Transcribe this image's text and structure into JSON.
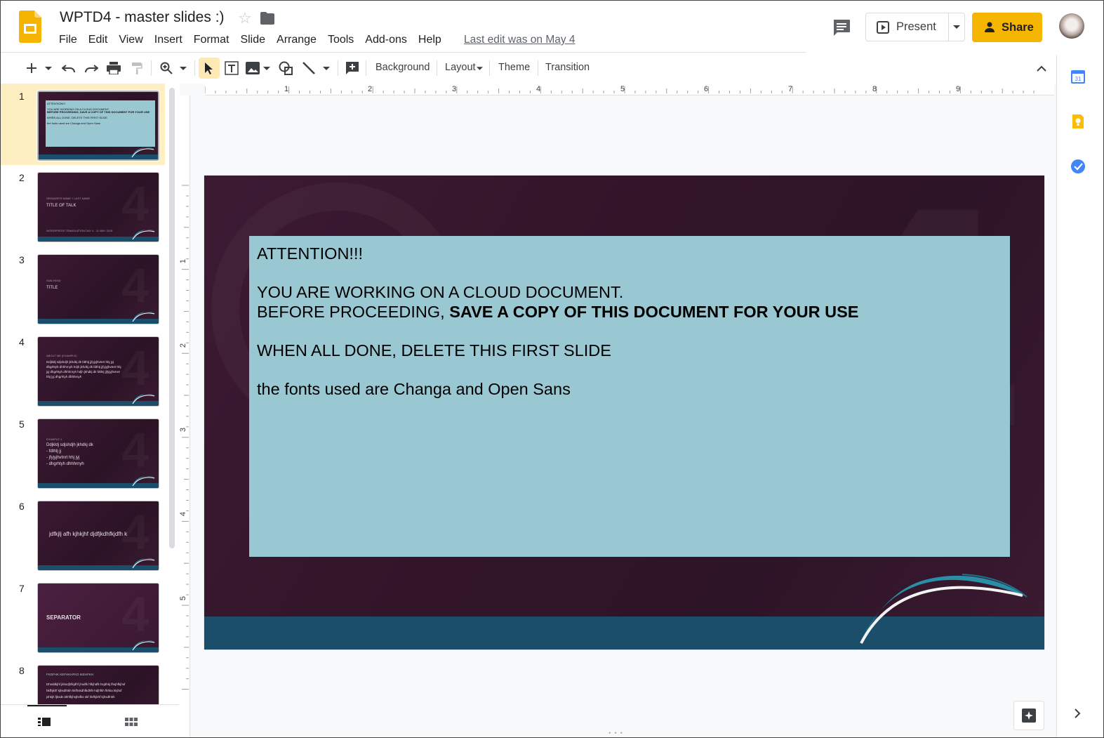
{
  "header": {
    "doc_title": "WPTD4 - master slides :)",
    "menu": [
      "File",
      "Edit",
      "View",
      "Insert",
      "Format",
      "Slide",
      "Arrange",
      "Tools",
      "Add-ons",
      "Help"
    ],
    "last_edit": "Last edit was on May 4",
    "present_label": "Present",
    "share_label": "Share",
    "accent_color": "#f6b500"
  },
  "toolbar": {
    "background_label": "Background",
    "layout_label": "Layout",
    "theme_label": "Theme",
    "transition_label": "Transition"
  },
  "filmstrip": {
    "slides": [
      {
        "num": "1",
        "lines": [
          "ATTENTION!!!",
          "YOU ARE WORKING ON A CLOUD DOCUMENT.",
          "BEFORE PROCEEDING, SAVE A COPY OF THIS DOCUMENT FOR YOUR USE",
          "WHEN ALL DONE, DELETE THIS FIRST SLIDE",
          "the fonts used are Changa and Open Sans"
        ]
      },
      {
        "num": "2",
        "lines": [
          "SPEAKER'S NAME + LAST NAME",
          "TITLE OF TALK",
          "WORDPRESS TRANSLATION DAY 4 - 11 MAY 2019"
        ]
      },
      {
        "num": "3",
        "lines": [
          "SUB-HEAD",
          "TITLE"
        ]
      },
      {
        "num": "4",
        "lines": [
          "ABOUT ME (EXAMPLE)",
          "Ddjkldj sdjshdjh jkhdkj dk fdthtj jjfyjyjhvtnrt hhj jyj",
          "dhgrhtyh dhhhrnyh hdjh jkhdkj dk fdthtj jjfyjyjhvtnrt hhj",
          "jyj dhgrhtyh dhhhrnyh hdjh jkhdkj dk fdthtj jjfyjyjhvtnrt",
          "hhj jyj dhgrhtyh dhhhrnyh"
        ]
      },
      {
        "num": "5",
        "lines": [
          "EXAMPLE 1",
          "Ddjkldj sdjshdjh jkhdkj dk",
          "- fdthtj jj",
          "- jfyjyjhvtnrt hhj jyj",
          "- dhgrhtyh dhhhrnyh"
        ]
      },
      {
        "num": "6",
        "lines": [
          "jdfkjlj afh kjhkjhf djdfjkdhfkjdfh k"
        ]
      },
      {
        "num": "7",
        "lines": [
          "SEPARATOR"
        ]
      },
      {
        "num": "8",
        "lines": [
          "FKDFHK KEFHKHFKD IKEHFKH",
          "Dhsddkjhf jkhsdjhfkjdhf jhsdfk hfkjhdfk hsjdhkj fhsjhfkjhsf",
          "hkfhjkhf kjhsdfnkh kkfhskdhfkdhfk-hdjhfkh fkhka kkjhsf",
          "jshkjh fjksdn kkhfkjhsjhsfks skf hkfhjkhf kjhsdfnkh"
        ]
      }
    ]
  },
  "slide": {
    "line1": "ATTENTION!!!",
    "line2": "YOU ARE WORKING ON A CLOUD DOCUMENT.",
    "line3_normal": "BEFORE PROCEEDING, ",
    "line3_bold": "SAVE A COPY OF THIS DOCUMENT FOR YOUR USE",
    "line4": "WHEN ALL DONE, DELETE THIS FIRST SLIDE",
    "line5": "the fonts used are Changa and Open Sans",
    "colors": {
      "background": "#3a1a31",
      "textbox": "#99c7d2",
      "band": "#1b4e6b"
    }
  },
  "rulers": {
    "horizontal": [
      "1",
      "2",
      "3",
      "4",
      "5",
      "6",
      "7",
      "8",
      "9"
    ],
    "vertical": [
      "1",
      "2",
      "3",
      "4",
      "5"
    ]
  },
  "icons": {
    "side_apps": [
      "calendar-icon",
      "keep-icon",
      "tasks-icon"
    ]
  }
}
